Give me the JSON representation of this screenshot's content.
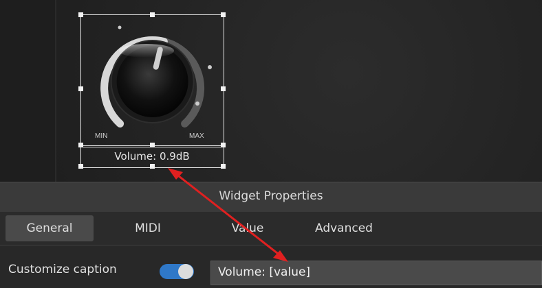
{
  "knob": {
    "min_label": "MIN",
    "max_label": "MAX",
    "caption": "Volume: 0.9dB",
    "value_fraction": 0.55
  },
  "properties_panel": {
    "title": "Widget Properties",
    "tabs": [
      {
        "label": "General",
        "active": true
      },
      {
        "label": "MIDI",
        "active": false
      },
      {
        "label": "Value",
        "active": false
      },
      {
        "label": "Advanced",
        "active": false
      }
    ],
    "customize_caption": {
      "label": "Customize caption",
      "enabled": true,
      "value": "Volume: [value]"
    }
  },
  "colors": {
    "accent": "#2f78c8",
    "annotation_arrow": "#e02020",
    "selection": "#e8e8e8"
  },
  "icons": [
    "knob-icon",
    "toggle-switch-icon",
    "double-arrow-annotation-icon"
  ]
}
